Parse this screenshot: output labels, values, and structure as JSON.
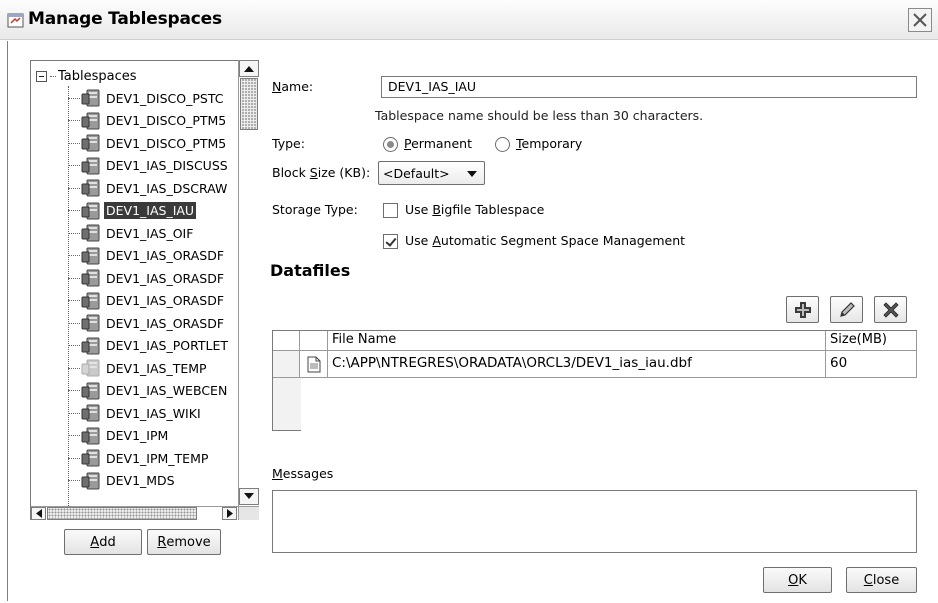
{
  "window": {
    "title": "Manage Tablespaces"
  },
  "tree": {
    "root_label": "Tablespaces",
    "items": [
      {
        "label": "DEV1_DISCO_PSTC",
        "selected": false
      },
      {
        "label": "DEV1_DISCO_PTM5",
        "selected": false
      },
      {
        "label": "DEV1_DISCO_PTM5",
        "selected": false
      },
      {
        "label": "DEV1_IAS_DISCUSS",
        "selected": false
      },
      {
        "label": "DEV1_IAS_DSCRAW",
        "selected": false
      },
      {
        "label": "DEV1_IAS_IAU",
        "selected": true
      },
      {
        "label": "DEV1_IAS_OIF",
        "selected": false
      },
      {
        "label": "DEV1_IAS_ORASDF",
        "selected": false
      },
      {
        "label": "DEV1_IAS_ORASDF",
        "selected": false
      },
      {
        "label": "DEV1_IAS_ORASDF",
        "selected": false
      },
      {
        "label": "DEV1_IAS_ORASDF",
        "selected": false
      },
      {
        "label": "DEV1_IAS_PORTLET",
        "selected": false
      },
      {
        "label": "DEV1_IAS_TEMP",
        "selected": false
      },
      {
        "label": "DEV1_IAS_WEBCEN",
        "selected": false
      },
      {
        "label": "DEV1_IAS_WIKI",
        "selected": false
      },
      {
        "label": "DEV1_IPM",
        "selected": false
      },
      {
        "label": "DEV1_IPM_TEMP",
        "selected": false
      },
      {
        "label": "DEV1_MDS",
        "selected": false
      }
    ],
    "add_button": {
      "mnemonic": "A",
      "rest": "dd"
    },
    "remove_button": {
      "mnemonic": "R",
      "rest": "emove"
    }
  },
  "form": {
    "name_label": {
      "mnemonic": "N",
      "rest": "ame:"
    },
    "name_value": "DEV1_IAS_IAU",
    "name_hint": "Tablespace name should be less than 30 characters.",
    "type_label": "Type:",
    "permanent": {
      "mnemonic": "P",
      "rest": "ermanent",
      "selected": true
    },
    "temporary": {
      "mnemonic": "T",
      "rest": "emporary",
      "selected": false
    },
    "block_size_label": {
      "pre": "Block ",
      "mnemonic": "S",
      "rest": "ize (KB):"
    },
    "block_size_value": "<Default>",
    "storage_type_label": "Storage Type:",
    "bigfile": {
      "pre": "Use ",
      "mnemonic": "B",
      "rest": "igfile Tablespace",
      "checked": false
    },
    "assm": {
      "pre": "Use ",
      "mnemonic": "A",
      "rest": "utomatic Segment Space Management",
      "checked": true
    }
  },
  "datafiles": {
    "title": "Datafiles",
    "columns": [
      "File Name",
      "Size(MB)"
    ],
    "rows": [
      {
        "file_name": "C:\\APP\\NTREGRES\\ORADATA\\ORCL3/DEV1_ias_iau.dbf",
        "size": "60"
      }
    ]
  },
  "messages": {
    "mnemonic": "M",
    "rest": "essages"
  },
  "footer": {
    "ok": {
      "mnemonic": "O",
      "rest": "K"
    },
    "close": {
      "mnemonic": "C",
      "rest": "lose"
    }
  }
}
